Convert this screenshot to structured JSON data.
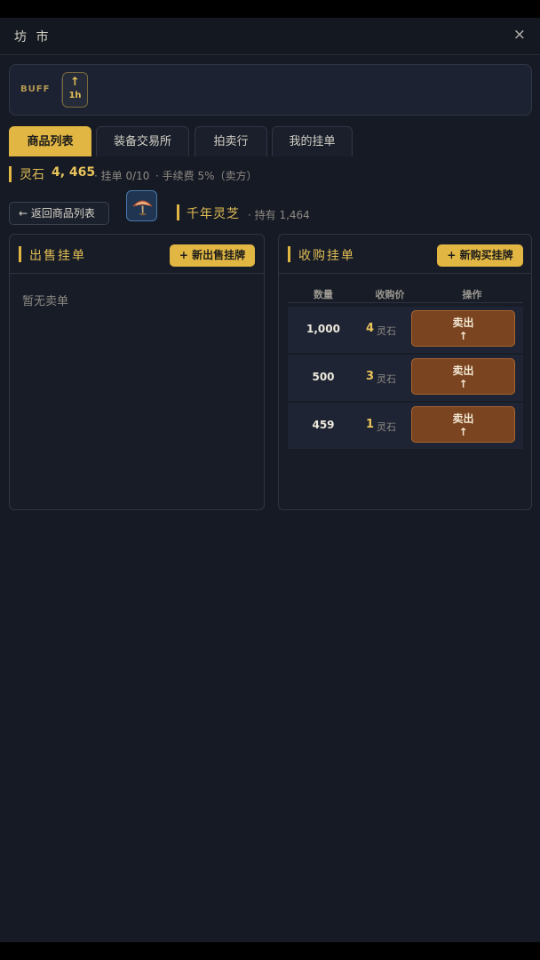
{
  "header": {
    "title": "坊 市",
    "close_icon": "×"
  },
  "buff": {
    "label": "BUFF",
    "icon_name": "arrow-up-icon",
    "duration": "1h"
  },
  "tabs": [
    {
      "label": "商品列表",
      "active": true
    },
    {
      "label": "装备交易所",
      "active": false
    },
    {
      "label": "拍卖行",
      "active": false
    },
    {
      "label": "我的挂单",
      "active": false
    }
  ],
  "stones": {
    "name": "灵石",
    "value": "4, 465",
    "listings": "· 挂单 0/10",
    "fee": "· 手续费 5%（卖方）"
  },
  "item": {
    "back_label": "← 返回商品列表",
    "icon_name": "lingzhi-icon",
    "name": "千年灵芝",
    "holding": "· 持有 1,464"
  },
  "sell_panel": {
    "title": "出售挂单",
    "button": "+ 新出售挂牌",
    "empty_text": "暂无卖单"
  },
  "buy_panel": {
    "title": "收购挂单",
    "button": "+ 新购买挂牌",
    "columns": [
      "数量",
      "收购价",
      "操作"
    ],
    "rows": [
      {
        "qty": "1,000",
        "price": "4",
        "unit": "灵石",
        "action": "卖出",
        "action_icon": "↑"
      },
      {
        "qty": "500",
        "price": "3",
        "unit": "灵石",
        "action": "卖出",
        "action_icon": "↑"
      },
      {
        "qty": "459",
        "price": "1",
        "unit": "灵石",
        "action": "卖出",
        "action_icon": "↑"
      }
    ]
  },
  "colors": {
    "gold": "#e1b642",
    "bg": "#161a24",
    "sell_button": "#7a4420",
    "item_icon_bg": "#1f3552"
  }
}
